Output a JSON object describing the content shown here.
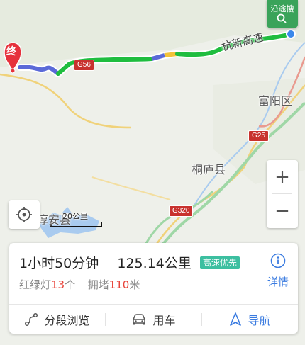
{
  "map": {
    "end_marker_label": "终",
    "labels": {
      "city_fuyang": "富阳区",
      "county_tonglu": "桐庐县",
      "chunan": "淳安县",
      "expressway": "杭新高速"
    },
    "shields": {
      "g56": "G56",
      "g25": "G25",
      "g320": "G320"
    },
    "scale_label": "20公里",
    "search_along_label": "沿途搜",
    "zoom_in": "+",
    "zoom_out": "−"
  },
  "route": {
    "duration": "1小时50分钟",
    "distance": "125.14公里",
    "strategy_badge": "高速优先",
    "traffic_lights_prefix": "红绿灯",
    "traffic_lights_count": "13",
    "traffic_lights_unit": "个",
    "congestion_prefix": "拥堵",
    "congestion_value": "110",
    "congestion_unit": "米",
    "detail_label": "详情"
  },
  "actions": {
    "segments": "分段浏览",
    "car": "用车",
    "navigate": "导航"
  },
  "colors": {
    "route_green": "#1fbd3f",
    "route_blue": "#5b6ad8",
    "route_yellow": "#f2c23a",
    "accent_blue": "#3a7be0",
    "badge_teal": "#3cbfa0",
    "alert_red": "#e8443a",
    "marker_red": "#e6323c"
  }
}
